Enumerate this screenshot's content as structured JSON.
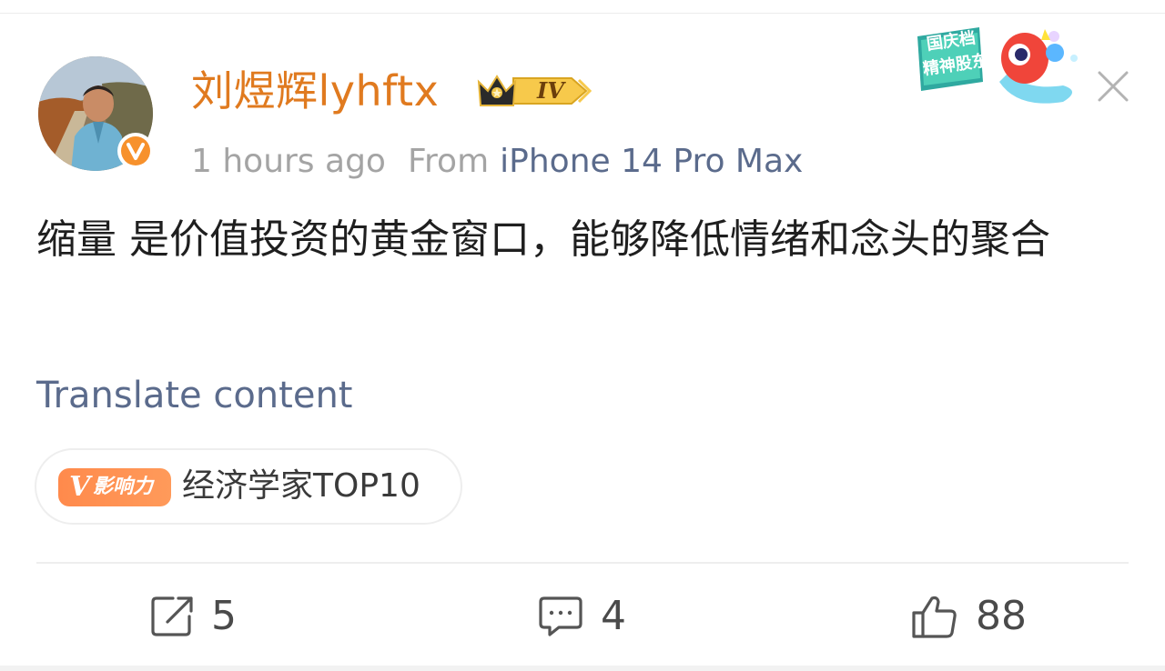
{
  "post": {
    "author_name": "刘煜辉lyhftx",
    "member_badge_level": "IV",
    "time": "1 hours ago",
    "from_label": "From",
    "device": "iPhone 14 Pro Max",
    "content": "缩量 是价值投资的黄金窗口，能够降低情绪和念头的聚合",
    "translate_label": "Translate content"
  },
  "promo_sticker": {
    "line1": "国庆档",
    "line2": "精神股东"
  },
  "influence_tag": {
    "icon_v": "V",
    "icon_text": "影响力",
    "label": "经济学家TOP10"
  },
  "actions": {
    "repost_count": "5",
    "comment_count": "4",
    "like_count": "88"
  },
  "icons": {
    "verify": "verified-v-icon",
    "close": "close-icon",
    "repost": "repost-icon",
    "comment": "comment-icon",
    "like": "thumbs-up-icon"
  },
  "colors": {
    "author_name": "#e07a1f",
    "link_blue": "#5b6b8c",
    "meta_gray": "#a4a4a4",
    "badge_orange": "#ff8a4c"
  }
}
